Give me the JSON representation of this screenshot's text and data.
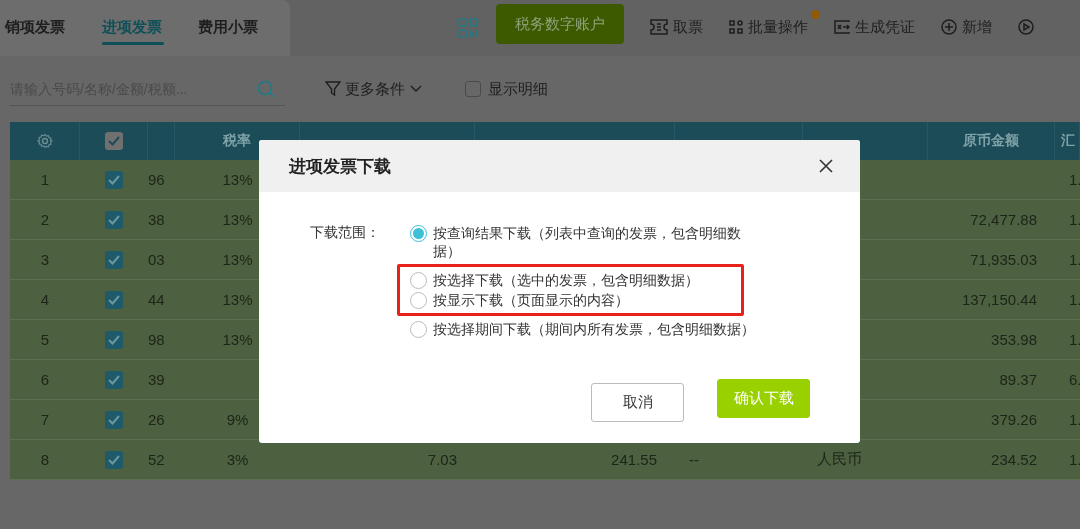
{
  "tabs": [
    {
      "label": "销项发票",
      "selected": false
    },
    {
      "label": "进项发票",
      "selected": true
    },
    {
      "label": "费用小票",
      "selected": false
    }
  ],
  "toolbar": {
    "primary_button": "税务数字账户",
    "actions": [
      {
        "kind": "ticket",
        "label": "取票"
      },
      {
        "kind": "batch",
        "label": "批量操作",
        "notification": true
      },
      {
        "kind": "voucher",
        "label": "生成凭证"
      },
      {
        "kind": "add",
        "label": "新增"
      },
      {
        "kind": "play"
      }
    ]
  },
  "search": {
    "placeholder": "请输入号码/名称/金额/税额..."
  },
  "filter": {
    "label": "更多条件"
  },
  "show_details": {
    "label": "显示明细",
    "checked": false
  },
  "table": {
    "header_checked": true,
    "columns": {
      "tax_rate": "税率",
      "original_amount": "原币金额",
      "column_10": "汇"
    },
    "rows": [
      {
        "index": "1",
        "checked": true,
        "column_3": "96",
        "tax_rate": "13%",
        "column_10": "1."
      },
      {
        "index": "2",
        "checked": true,
        "column_3": "38",
        "tax_rate": "13%",
        "original_amount": "72,477.88",
        "column_10": "1."
      },
      {
        "index": "3",
        "checked": true,
        "column_3": "03",
        "tax_rate": "13%",
        "original_amount": "71,935.03",
        "column_10": "1."
      },
      {
        "index": "4",
        "checked": true,
        "column_3": "44",
        "tax_rate": "13%",
        "original_amount": "137,150.44",
        "column_10": "1."
      },
      {
        "index": "5",
        "checked": true,
        "column_3": "98",
        "tax_rate": "13%",
        "original_amount": "353.98",
        "column_10": "1."
      },
      {
        "index": "6",
        "checked": true,
        "column_3": "39",
        "original_amount": "89.37",
        "column_10": "6."
      },
      {
        "index": "7",
        "checked": true,
        "column_3": "26",
        "tax_rate": "9%",
        "original_amount": "379.26",
        "column_10": "1."
      },
      {
        "index": "8",
        "checked": true,
        "column_3": "52",
        "tax_rate": "3%",
        "tax_amount": "7.03",
        "total": "241.55",
        "purchase_no": "--",
        "currency": "人民币",
        "original_amount": "234.52",
        "column_10": "1."
      }
    ]
  },
  "modal": {
    "title": "进项发票下载",
    "label": "下载范围：",
    "options": [
      {
        "label": "按查询结果下载（列表中查询的发票，包含明细数据）",
        "selected": true,
        "highlighted": false
      },
      {
        "label": "按选择下载（选中的发票，包含明细数据）",
        "selected": false,
        "highlighted": true
      },
      {
        "label": "按显示下载（页面显示的内容）",
        "selected": false,
        "highlighted": true
      },
      {
        "label": "按选择期间下载（期间内所有发票，包含明细数据）",
        "selected": false,
        "highlighted": false
      }
    ],
    "buttons": [
      {
        "kind": "secondary",
        "label": "取消"
      },
      {
        "kind": "primary",
        "label": "确认下载"
      }
    ]
  }
}
